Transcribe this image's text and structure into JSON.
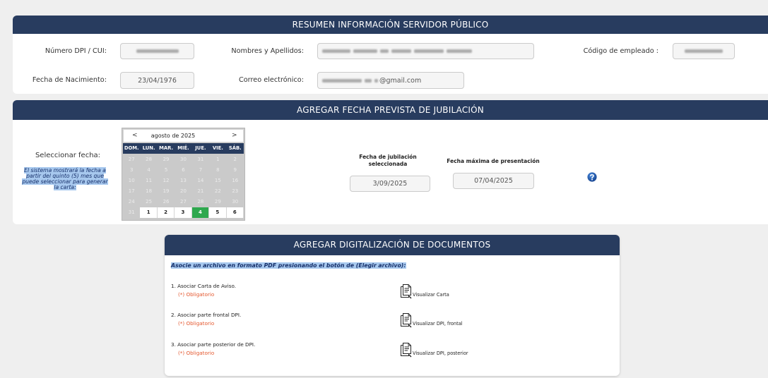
{
  "colors": {
    "page_bg": "#efefef",
    "header_bg": "#283c5f",
    "selected_day_bg": "#2ea84e",
    "required_text": "#e4572e",
    "highlight_bg": "#a7c8ee",
    "highlight_text": "#17306a"
  },
  "summary": {
    "title": "RESUMEN INFORMACIÓN SERVIDOR PÚBLICO",
    "dpi": {
      "label": "Número DPI / CUI:",
      "redacted": true
    },
    "names": {
      "label": "Nombres y Apellidos:",
      "redacted": true
    },
    "employee_code": {
      "label": "Código de empleado :",
      "redacted": true
    },
    "birth_date": {
      "label": "Fecha de Nacimiento:",
      "value": "23/04/1976"
    },
    "email": {
      "label": "Correo electrónico:",
      "value": "@gmail.com",
      "redacted_prefix": true
    }
  },
  "retirement": {
    "title": "AGREGAR FECHA PREVISTA DE JUBILACIÓN",
    "select_label": "Seleccionar fecha:",
    "note": "El sistema mostrará la fecha a partir del quinto (5) mes que puede seleccionar para generar la carta:",
    "calendar": {
      "prev": "<",
      "month_label": "agosto de 2025",
      "next": ">",
      "weekdays": [
        "DOM.",
        "LUN.",
        "MAR.",
        "MIÉ.",
        "JUE.",
        "VIE.",
        "SÁB."
      ],
      "weeks": [
        [
          {
            "d": "27",
            "enabled": false
          },
          {
            "d": "28",
            "enabled": false
          },
          {
            "d": "29",
            "enabled": false
          },
          {
            "d": "30",
            "enabled": false
          },
          {
            "d": "31",
            "enabled": false
          },
          {
            "d": "1",
            "enabled": false
          },
          {
            "d": "2",
            "enabled": false
          }
        ],
        [
          {
            "d": "3",
            "enabled": false
          },
          {
            "d": "4",
            "enabled": false
          },
          {
            "d": "5",
            "enabled": false
          },
          {
            "d": "6",
            "enabled": false
          },
          {
            "d": "7",
            "enabled": false
          },
          {
            "d": "8",
            "enabled": false
          },
          {
            "d": "9",
            "enabled": false
          }
        ],
        [
          {
            "d": "10",
            "enabled": false
          },
          {
            "d": "11",
            "enabled": false
          },
          {
            "d": "12",
            "enabled": false
          },
          {
            "d": "13",
            "enabled": false
          },
          {
            "d": "14",
            "enabled": false
          },
          {
            "d": "15",
            "enabled": false
          },
          {
            "d": "16",
            "enabled": false
          }
        ],
        [
          {
            "d": "17",
            "enabled": false
          },
          {
            "d": "18",
            "enabled": false
          },
          {
            "d": "19",
            "enabled": false
          },
          {
            "d": "20",
            "enabled": false
          },
          {
            "d": "21",
            "enabled": false
          },
          {
            "d": "22",
            "enabled": false
          },
          {
            "d": "23",
            "enabled": false
          }
        ],
        [
          {
            "d": "24",
            "enabled": false
          },
          {
            "d": "25",
            "enabled": false
          },
          {
            "d": "26",
            "enabled": false
          },
          {
            "d": "27",
            "enabled": false
          },
          {
            "d": "28",
            "enabled": false
          },
          {
            "d": "29",
            "enabled": false
          },
          {
            "d": "30",
            "enabled": false
          }
        ],
        [
          {
            "d": "31",
            "enabled": false
          },
          {
            "d": "1",
            "enabled": true
          },
          {
            "d": "2",
            "enabled": true
          },
          {
            "d": "3",
            "enabled": true
          },
          {
            "d": "4",
            "enabled": true,
            "selected": true
          },
          {
            "d": "5",
            "enabled": true
          },
          {
            "d": "6",
            "enabled": true
          }
        ]
      ]
    },
    "selected_date": {
      "label": "Fecha de jubilación seleccionada",
      "value": "3/09/2025"
    },
    "max_date": {
      "label": "Fecha máxima de presentación",
      "value": "07/04/2025"
    },
    "help_icon": "question-circle-icon"
  },
  "documents": {
    "title": "AGREGAR DIGITALIZACIÓN DE DOCUMENTOS",
    "instruction": "Asocie un archivo en formato PDF presionando el botón de (Elegir archivo):",
    "items": [
      {
        "label": "1. Asociar Carta de Aviso.",
        "required": "(*) Obligatorio",
        "view_label": "Visualizar Carta",
        "icon": "document-view-icon"
      },
      {
        "label": "2. Asociar parte frontal DPI.",
        "required": "(*) Obligatorio",
        "view_label": "Visualizar DPI, frontal",
        "icon": "document-view-icon"
      },
      {
        "label": "3. Asociar parte posterior de DPI.",
        "required": "(*) Obligatorio",
        "view_label": "Visualizar DPI, posterior",
        "icon": "document-view-icon"
      }
    ]
  }
}
